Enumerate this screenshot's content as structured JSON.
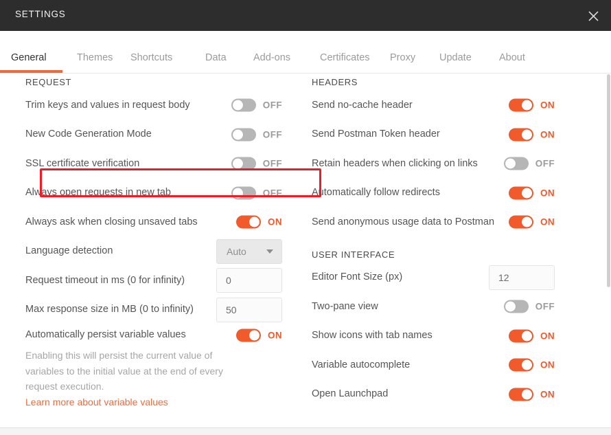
{
  "window": {
    "title": "SETTINGS",
    "close_icon": "close-icon"
  },
  "tabs": [
    {
      "label": "General",
      "active": true
    },
    {
      "label": "Themes",
      "active": false
    },
    {
      "label": "Shortcuts",
      "active": false
    },
    {
      "label": "Data",
      "active": false
    },
    {
      "label": "Add-ons",
      "active": false
    },
    {
      "label": "Certificates",
      "active": false
    },
    {
      "label": "Proxy",
      "active": false
    },
    {
      "label": "Update",
      "active": false
    },
    {
      "label": "About",
      "active": false
    }
  ],
  "colors": {
    "accent": "#f15a2b",
    "tab_underline": "#ec6a3c",
    "link": "#ed6c3c",
    "titlebar": "#2d2d2d",
    "highlight": "#ee1c25",
    "toggle_off_track": "#b6b6b6"
  },
  "left_column": {
    "section_title": "REQUEST",
    "rows": [
      {
        "label": "Trim keys and values in request body",
        "control": "toggle",
        "state": "OFF"
      },
      {
        "label": "New Code Generation Mode",
        "control": "toggle",
        "state": "OFF"
      },
      {
        "label": "SSL certificate verification",
        "control": "toggle",
        "state": "OFF",
        "highlighted": true
      },
      {
        "label": "Always open requests in new tab",
        "control": "toggle",
        "state": "OFF"
      },
      {
        "label": "Always ask when closing unsaved tabs",
        "control": "toggle",
        "state": "ON"
      },
      {
        "label": "Language detection",
        "control": "select",
        "value": "Auto"
      },
      {
        "label": "Request timeout in ms (0 for infinity)",
        "control": "input",
        "value": "0"
      },
      {
        "label": "Max response size in MB (0 to infinity)",
        "control": "input",
        "value": "50"
      }
    ],
    "persist": {
      "label": "Automatically persist variable values",
      "state": "ON",
      "description": "Enabling this will persist the current value of variables to the initial value at the end of every request execution.",
      "link": "Learn more about variable values"
    }
  },
  "right_column": {
    "headers_section": {
      "section_title": "HEADERS",
      "rows": [
        {
          "label": "Send no-cache header",
          "control": "toggle",
          "state": "ON"
        },
        {
          "label": "Send Postman Token header",
          "control": "toggle",
          "state": "ON"
        },
        {
          "label": "Retain headers when clicking on links",
          "control": "toggle",
          "state": "OFF"
        },
        {
          "label": "Automatically follow redirects",
          "control": "toggle",
          "state": "ON"
        },
        {
          "label": "Send anonymous usage data to Postman",
          "control": "toggle",
          "state": "ON"
        }
      ]
    },
    "ui_section": {
      "section_title": "USER INTERFACE",
      "rows": [
        {
          "label": "Editor Font Size (px)",
          "control": "input",
          "value": "12"
        },
        {
          "label": "Two-pane view",
          "control": "toggle",
          "state": "OFF"
        },
        {
          "label": "Show icons with tab names",
          "control": "toggle",
          "state": "ON"
        },
        {
          "label": "Variable autocomplete",
          "control": "toggle",
          "state": "ON"
        },
        {
          "label": "Open Launchpad",
          "control": "toggle",
          "state": "ON"
        }
      ]
    }
  }
}
